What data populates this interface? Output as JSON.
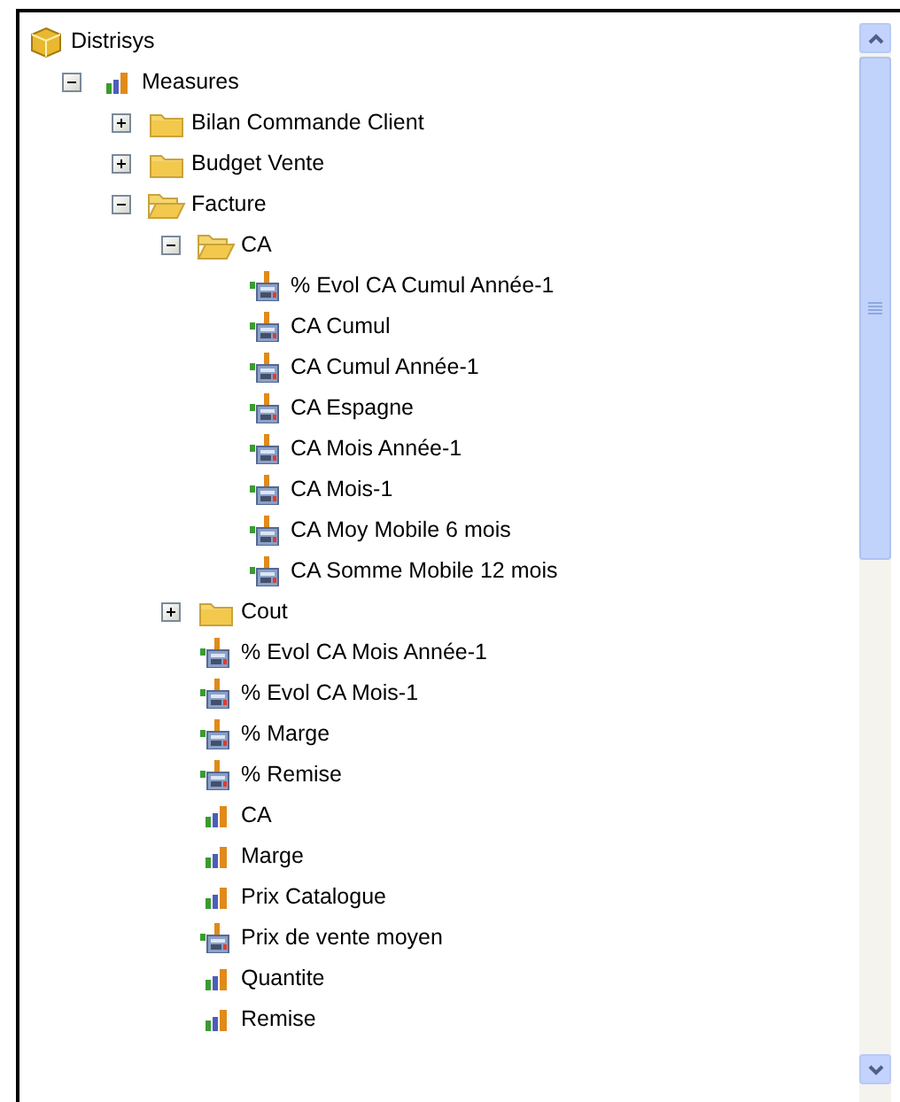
{
  "tree": [
    {
      "label": "Distrisys",
      "kind": "cube",
      "children": [
        {
          "label": "Measures",
          "kind": "measures",
          "expanded": true,
          "children": [
            {
              "label": "Bilan Commande Client",
              "kind": "folder",
              "expanded": false
            },
            {
              "label": "Budget Vente",
              "kind": "folder",
              "expanded": false
            },
            {
              "label": "Facture",
              "kind": "folder",
              "expanded": true,
              "children": [
                {
                  "label": "CA",
                  "kind": "folder",
                  "expanded": true,
                  "children": [
                    {
                      "label": "% Evol CA Cumul Année-1",
                      "kind": "calculated"
                    },
                    {
                      "label": "CA Cumul",
                      "kind": "calculated"
                    },
                    {
                      "label": "CA Cumul Année-1",
                      "kind": "calculated"
                    },
                    {
                      "label": "CA Espagne",
                      "kind": "calculated"
                    },
                    {
                      "label": "CA Mois Année-1",
                      "kind": "calculated"
                    },
                    {
                      "label": "CA Mois-1",
                      "kind": "calculated"
                    },
                    {
                      "label": "CA Moy Mobile 6 mois",
                      "kind": "calculated"
                    },
                    {
                      "label": "CA Somme Mobile 12 mois",
                      "kind": "calculated"
                    }
                  ]
                },
                {
                  "label": "Cout",
                  "kind": "folder",
                  "expanded": false
                },
                {
                  "label": "% Evol CA Mois Année-1",
                  "kind": "calculated"
                },
                {
                  "label": "% Evol CA Mois-1",
                  "kind": "calculated"
                },
                {
                  "label": "% Marge",
                  "kind": "calculated"
                },
                {
                  "label": "% Remise",
                  "kind": "calculated"
                },
                {
                  "label": "CA",
                  "kind": "measure"
                },
                {
                  "label": "Marge",
                  "kind": "measure"
                },
                {
                  "label": "Prix Catalogue",
                  "kind": "measure"
                },
                {
                  "label": "Prix de vente moyen",
                  "kind": "calculated"
                },
                {
                  "label": "Quantite",
                  "kind": "measure"
                },
                {
                  "label": "Remise",
                  "kind": "measure"
                }
              ]
            }
          ]
        }
      ]
    }
  ]
}
